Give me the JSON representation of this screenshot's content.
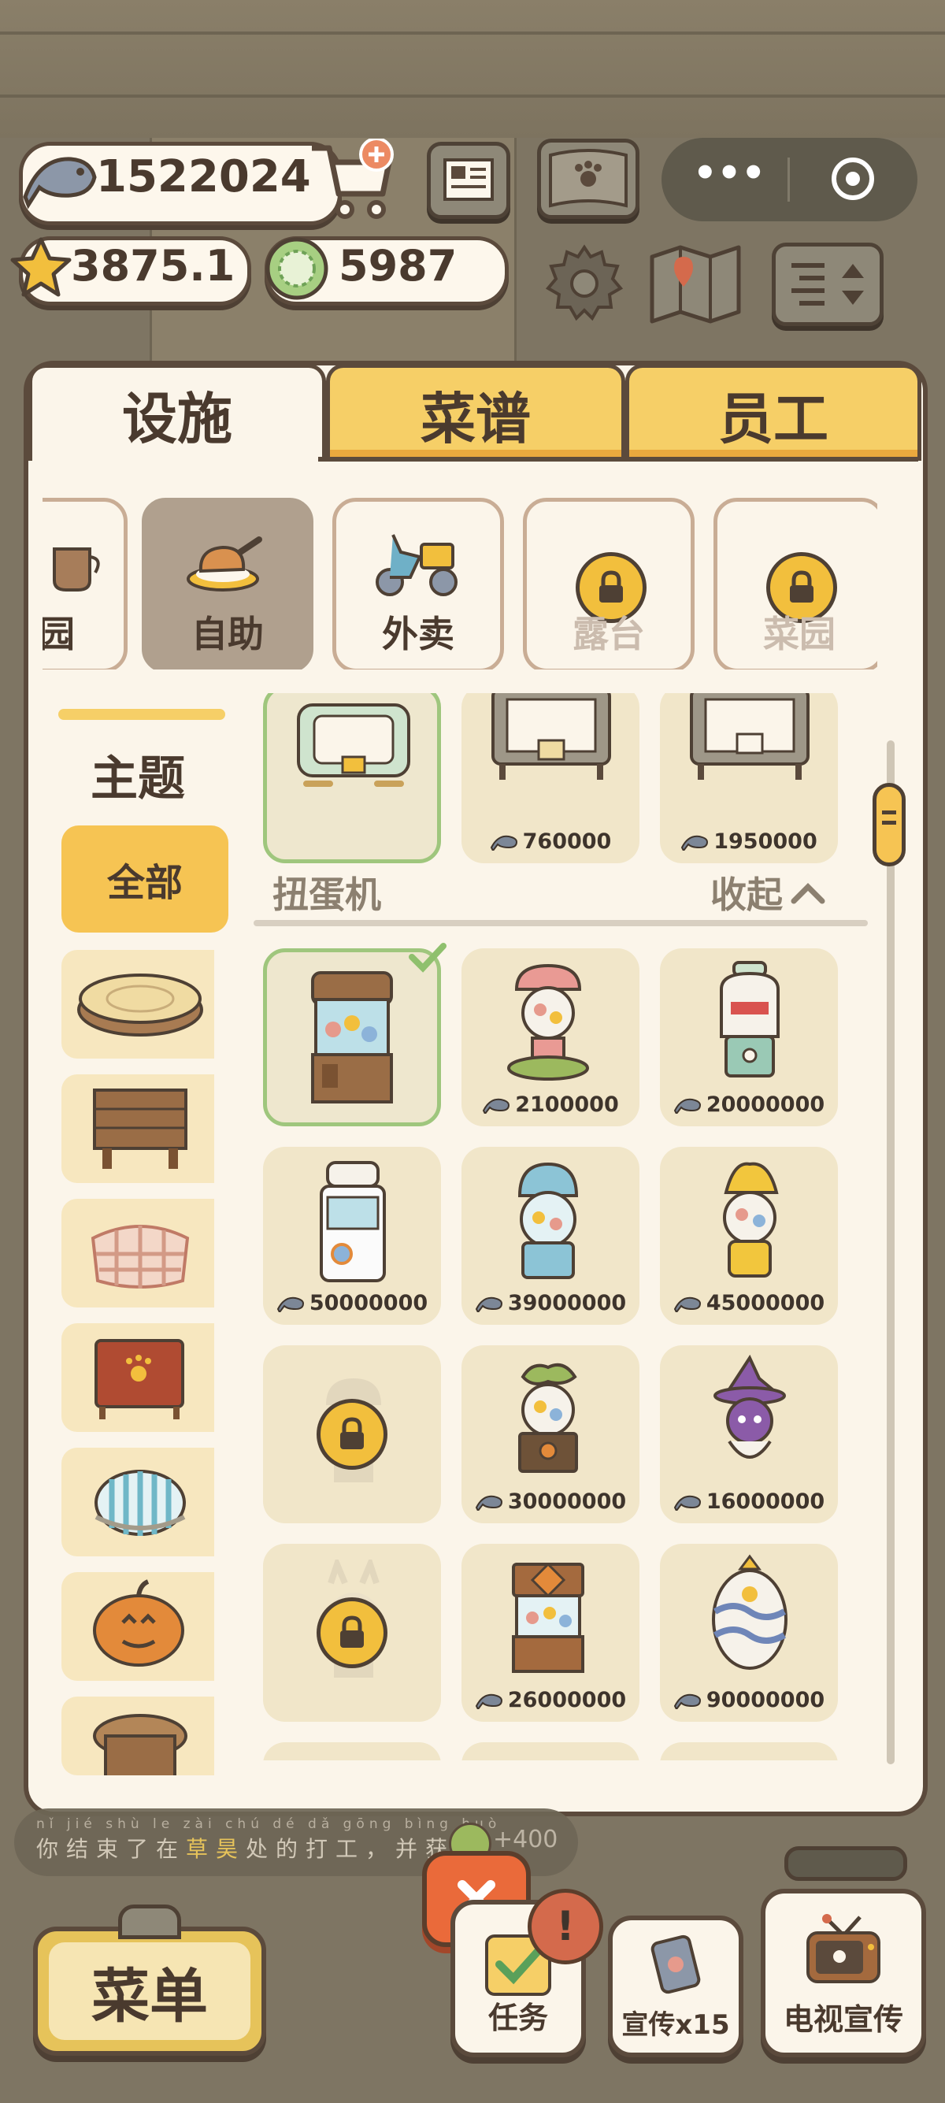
{
  "currency": {
    "fish": "1522024",
    "stars": "3875.1",
    "gems": "5987"
  },
  "tabs": [
    "设施",
    "菜谱",
    "员工"
  ],
  "categories": [
    {
      "label": "园",
      "state": "partial"
    },
    {
      "label": "自助",
      "state": "selected"
    },
    {
      "label": "外卖",
      "state": "normal"
    },
    {
      "label": "露台",
      "state": "locked"
    },
    {
      "label": "菜园",
      "state": "locked"
    }
  ],
  "theme": {
    "title": "主题",
    "all": "全部"
  },
  "section": {
    "title": "扭蛋机",
    "collapse": "收起"
  },
  "top_prices": [
    "760000",
    "1950000"
  ],
  "items": [
    {
      "price": "",
      "state": "owned"
    },
    {
      "price": "2100000",
      "state": "buy"
    },
    {
      "price": "20000000",
      "state": "buy"
    },
    {
      "price": "50000000",
      "state": "buy"
    },
    {
      "price": "39000000",
      "state": "buy"
    },
    {
      "price": "45000000",
      "state": "buy"
    },
    {
      "price": "",
      "state": "locked"
    },
    {
      "price": "30000000",
      "state": "buy"
    },
    {
      "price": "16000000",
      "state": "buy"
    },
    {
      "price": "",
      "state": "locked"
    },
    {
      "price": "26000000",
      "state": "buy"
    },
    {
      "price": "90000000",
      "state": "buy"
    }
  ],
  "ticker": {
    "pinyin": "nǐ jié shù le zài chú dé dǎ gōng bìng huò",
    "text_pre": "你结束了在",
    "highlight": "草昊",
    "text_post": "处的打工，并获",
    "reward": "+400"
  },
  "bottom": {
    "menu": "菜单",
    "task": "任务",
    "promo": "宣传x15",
    "tv": "电视宣传"
  },
  "colors": {
    "accent_yellow": "#f6cf67",
    "panel_bg": "#fbf5ea",
    "border_brown": "#5b4a3c",
    "close_orange": "#ea6a3a",
    "owned_green": "#9fc67d"
  }
}
